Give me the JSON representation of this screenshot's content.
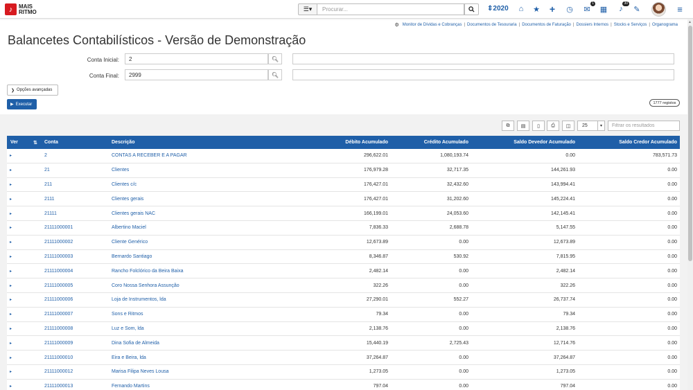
{
  "logo": {
    "line1": "MAIS",
    "line2": "RITMO",
    "mark": "♪"
  },
  "search": {
    "placeholder": "Procurar..."
  },
  "header": {
    "year": "2020",
    "notifications_badge": "1",
    "alerts_badge": "30"
  },
  "quicklinks": [
    "Monitor de Dívidas e Cobranças",
    "Documentos de Tesouraria",
    "Documentos de Faturação",
    "Dossiers Internos",
    "Stocks e Serviços",
    "Organograma"
  ],
  "page": {
    "title": "Balancetes Contabilísticos - Versão de Demonstração"
  },
  "form": {
    "conta_inicial_label": "Conta Inicial:",
    "conta_inicial_value": "2",
    "conta_final_label": "Conta Final:",
    "conta_final_value": "2999",
    "advanced_label": "Opções avançadas",
    "run_label": "Executar"
  },
  "results": {
    "records": "1777 registos",
    "page_size": "25",
    "filter_placeholder": "Filtrar os resultados"
  },
  "table": {
    "headers": {
      "ver": "Ver",
      "conta": "Conta",
      "descricao": "Descrição",
      "debito": "Débito Acumulado",
      "credito": "Crédito Acumulado",
      "saldo_devedor": "Saldo Devedor Acumulado",
      "saldo_credor": "Saldo Credor Acumulado"
    },
    "rows": [
      {
        "conta": "2",
        "descricao": "CONTAS A RECEBER E A PAGAR",
        "debito": "296,622.01",
        "credito": "1,080,193.74",
        "saldo_devedor": "0.00",
        "saldo_credor": "783,571.73"
      },
      {
        "conta": "21",
        "descricao": "Clientes",
        "debito": "176,979.28",
        "credito": "32,717.35",
        "saldo_devedor": "144,261.93",
        "saldo_credor": "0.00"
      },
      {
        "conta": "211",
        "descricao": "Clientes c/c",
        "debito": "176,427.01",
        "credito": "32,432.60",
        "saldo_devedor": "143,994.41",
        "saldo_credor": "0.00"
      },
      {
        "conta": "2111",
        "descricao": "Clientes gerais",
        "debito": "176,427.01",
        "credito": "31,202.60",
        "saldo_devedor": "145,224.41",
        "saldo_credor": "0.00"
      },
      {
        "conta": "21111",
        "descricao": "Clientes gerais NAC",
        "debito": "166,199.01",
        "credito": "24,053.60",
        "saldo_devedor": "142,145.41",
        "saldo_credor": "0.00"
      },
      {
        "conta": "21111000001",
        "descricao": "Albertino Maciel",
        "debito": "7,836.33",
        "credito": "2,688.78",
        "saldo_devedor": "5,147.55",
        "saldo_credor": "0.00"
      },
      {
        "conta": "21111000002",
        "descricao": "Cliente Genérico",
        "debito": "12,673.89",
        "credito": "0.00",
        "saldo_devedor": "12,673.89",
        "saldo_credor": "0.00"
      },
      {
        "conta": "21111000003",
        "descricao": "Bernardo Santiago",
        "debito": "8,346.87",
        "credito": "530.92",
        "saldo_devedor": "7,815.95",
        "saldo_credor": "0.00"
      },
      {
        "conta": "21111000004",
        "descricao": "Rancho Folclórico da Beira Baixa",
        "debito": "2,482.14",
        "credito": "0.00",
        "saldo_devedor": "2,482.14",
        "saldo_credor": "0.00"
      },
      {
        "conta": "21111000005",
        "descricao": "Coro Nossa Senhora Assunção",
        "debito": "322.26",
        "credito": "0.00",
        "saldo_devedor": "322.26",
        "saldo_credor": "0.00"
      },
      {
        "conta": "21111000006",
        "descricao": "Loja de Instrumentos, lda",
        "debito": "27,290.01",
        "credito": "552.27",
        "saldo_devedor": "26,737.74",
        "saldo_credor": "0.00"
      },
      {
        "conta": "21111000007",
        "descricao": "Sons e Ritmos",
        "debito": "79.34",
        "credito": "0.00",
        "saldo_devedor": "79.34",
        "saldo_credor": "0.00"
      },
      {
        "conta": "21111000008",
        "descricao": "Luz e Som, lda",
        "debito": "2,138.76",
        "credito": "0.00",
        "saldo_devedor": "2,138.76",
        "saldo_credor": "0.00"
      },
      {
        "conta": "21111000009",
        "descricao": "Dina Sofia de Almeida",
        "debito": "15,440.19",
        "credito": "2,725.43",
        "saldo_devedor": "12,714.76",
        "saldo_credor": "0.00"
      },
      {
        "conta": "21111000010",
        "descricao": "Eira e Beira, lda",
        "debito": "37,264.87",
        "credito": "0.00",
        "saldo_devedor": "37,264.87",
        "saldo_credor": "0.00"
      },
      {
        "conta": "21111000012",
        "descricao": "Marisa Filipa Neves Lousa",
        "debito": "1,273.05",
        "credito": "0.00",
        "saldo_devedor": "1,273.05",
        "saldo_credor": "0.00"
      },
      {
        "conta": "21111000013",
        "descricao": "Fernando Martins",
        "debito": "797.04",
        "credito": "0.00",
        "saldo_devedor": "797.04",
        "saldo_credor": "0.00"
      }
    ]
  }
}
